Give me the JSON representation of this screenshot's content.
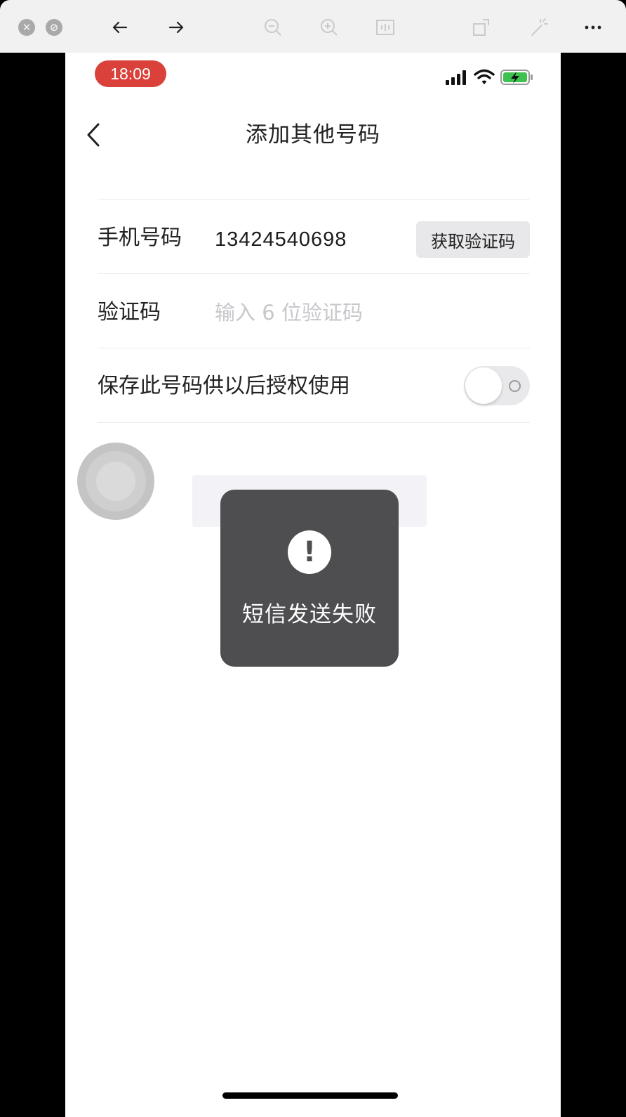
{
  "status_bar": {
    "time": "18:09",
    "signal_icon": "cellular-signal-icon",
    "wifi_icon": "wifi-icon",
    "battery_icon": "battery-charging-icon",
    "time_pill_color": "#d9413a"
  },
  "nav": {
    "title": "添加其他号码",
    "back_icon": "chevron-left-icon"
  },
  "form": {
    "phone_label": "手机号码",
    "phone_value": "13424540698",
    "get_code_button": "获取验证码",
    "code_label": "验证码",
    "code_placeholder": "输入 6 位验证码",
    "save_label": "保存此号码供以后授权使用",
    "save_toggle_on": false
  },
  "toast": {
    "icon": "exclamation-icon",
    "message": "短信发送失败"
  }
}
